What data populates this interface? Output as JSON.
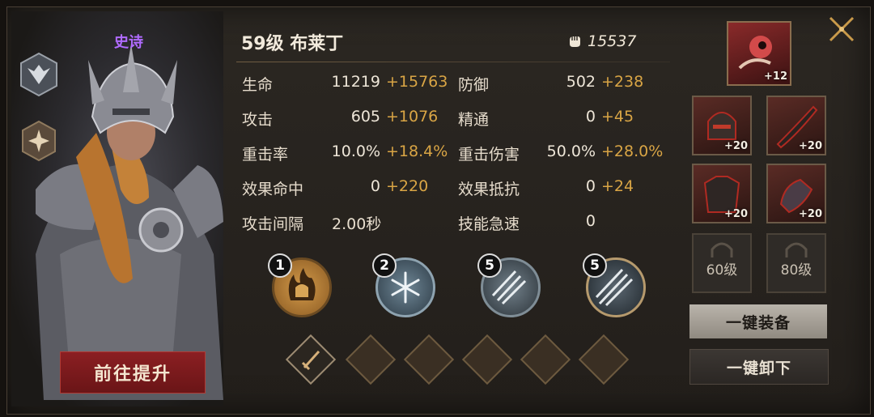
{
  "hero": {
    "rarity": "史诗",
    "upgrade_button": "前往提升"
  },
  "header": {
    "title": "59级 布莱丁",
    "power": "15537"
  },
  "stats": [
    {
      "label": "生命",
      "value": "11219",
      "bonus": "+15763"
    },
    {
      "label": "防御",
      "value": "502",
      "bonus": "+238"
    },
    {
      "label": "攻击",
      "value": "605",
      "bonus": "+1076"
    },
    {
      "label": "精通",
      "value": "0",
      "bonus": "+45"
    },
    {
      "label": "重击率",
      "value": "10.0%",
      "bonus": "+18.4%"
    },
    {
      "label": "重击伤害",
      "value": "50.0%",
      "bonus": "+28.0%"
    },
    {
      "label": "效果命中",
      "value": "0",
      "bonus": "+220"
    },
    {
      "label": "效果抵抗",
      "value": "0",
      "bonus": "+24"
    },
    {
      "label": "攻击间隔",
      "value": "2.00秒",
      "bonus": ""
    },
    {
      "label": "技能急速",
      "value": "0",
      "bonus": ""
    }
  ],
  "skills": [
    {
      "level": "1",
      "icon": "flame-helmet-icon"
    },
    {
      "level": "2",
      "icon": "snowflake-icon"
    },
    {
      "level": "5",
      "icon": "triple-spear-icon"
    },
    {
      "level": "5",
      "icon": "spear-volley-icon"
    }
  ],
  "equipment": {
    "artifact_level": "+12",
    "items": [
      {
        "name": "helmet",
        "level": "+20"
      },
      {
        "name": "weapon",
        "level": "+20"
      },
      {
        "name": "armor",
        "level": "+20"
      },
      {
        "name": "gauntlet",
        "level": "+20"
      }
    ],
    "locked_slots": [
      "60级",
      "80级"
    ],
    "equip_all": "一键装备",
    "unequip_all": "一键卸下"
  },
  "colors": {
    "bonus": "#d9a545",
    "rarity": "#b06bff",
    "upgrade": "#8b1f22"
  }
}
